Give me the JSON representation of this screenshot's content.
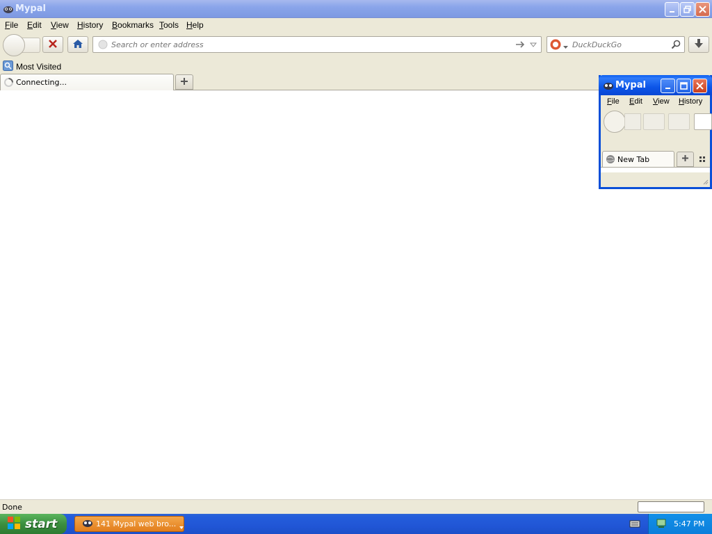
{
  "window": {
    "title": "Mypal",
    "menu": [
      "File",
      "Edit",
      "View",
      "History",
      "Bookmarks",
      "Tools",
      "Help"
    ]
  },
  "navbar": {
    "url_placeholder": "Search or enter address",
    "search_engine": "DuckDuckGo"
  },
  "bookmarks": {
    "items": [
      "Most Visited"
    ]
  },
  "tabs": [
    {
      "label": "Connecting..."
    }
  ],
  "status": {
    "text": "Done"
  },
  "popup_window": {
    "title": "Mypal",
    "menu": [
      "File",
      "Edit",
      "View",
      "History"
    ],
    "tab_label": "New Tab"
  },
  "taskbar": {
    "start_label": "start",
    "task_label": "141 Mypal web bro...",
    "clock": "5:47 PM"
  },
  "colors": {
    "titlebar_inactive": "#8aa5ea",
    "titlebar_active": "#0a5ef0",
    "taskbar": "#245edb",
    "start_green": "#3c8f3f",
    "task_orange": "#e27e1c"
  }
}
